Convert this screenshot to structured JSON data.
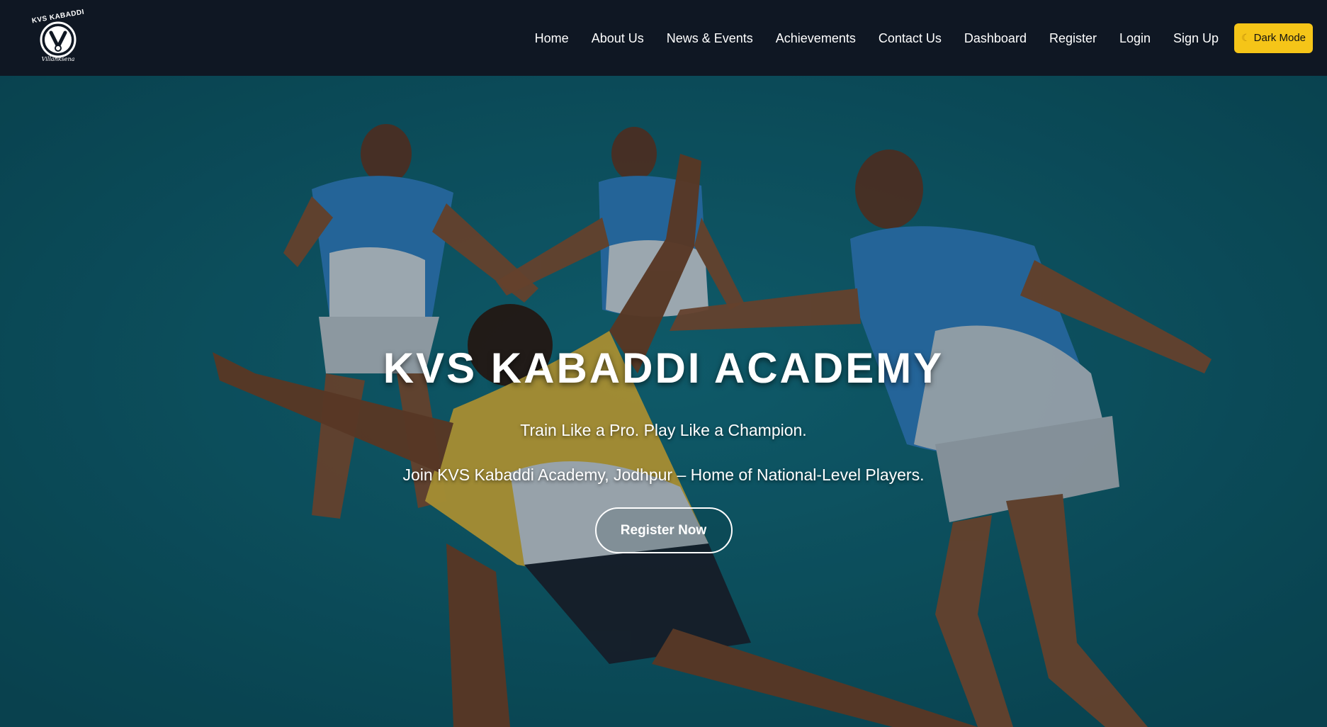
{
  "brand": {
    "logo_top_text": "KVS KABADDI",
    "logo_bottom_text": "Villanksena",
    "logo_icon": "kabaddi-emblem-icon"
  },
  "nav": {
    "items": [
      {
        "label": "Home"
      },
      {
        "label": "About Us"
      },
      {
        "label": "News & Events"
      },
      {
        "label": "Achievements"
      },
      {
        "label": "Contact Us"
      },
      {
        "label": "Dashboard"
      },
      {
        "label": "Register"
      },
      {
        "label": "Login"
      },
      {
        "label": "Sign Up"
      }
    ],
    "theme_toggle": {
      "icon": "moon-icon",
      "label": "Dark Mode"
    }
  },
  "hero": {
    "title": "KVS KABADDI ACADEMY",
    "tagline": "Train Like a Pro. Play Like a Champion.",
    "subtitle": "Join KVS Kabaddi Academy, Jodhpur – Home of National-Level Players.",
    "cta_label": "Register Now",
    "background_image": "illustration of kabaddi players in blue and yellow jerseys"
  },
  "colors": {
    "navbar_bg": "#0f1723",
    "hero_bg": "#0e5866",
    "accent_yellow": "#f5c518",
    "text": "#ffffff"
  }
}
